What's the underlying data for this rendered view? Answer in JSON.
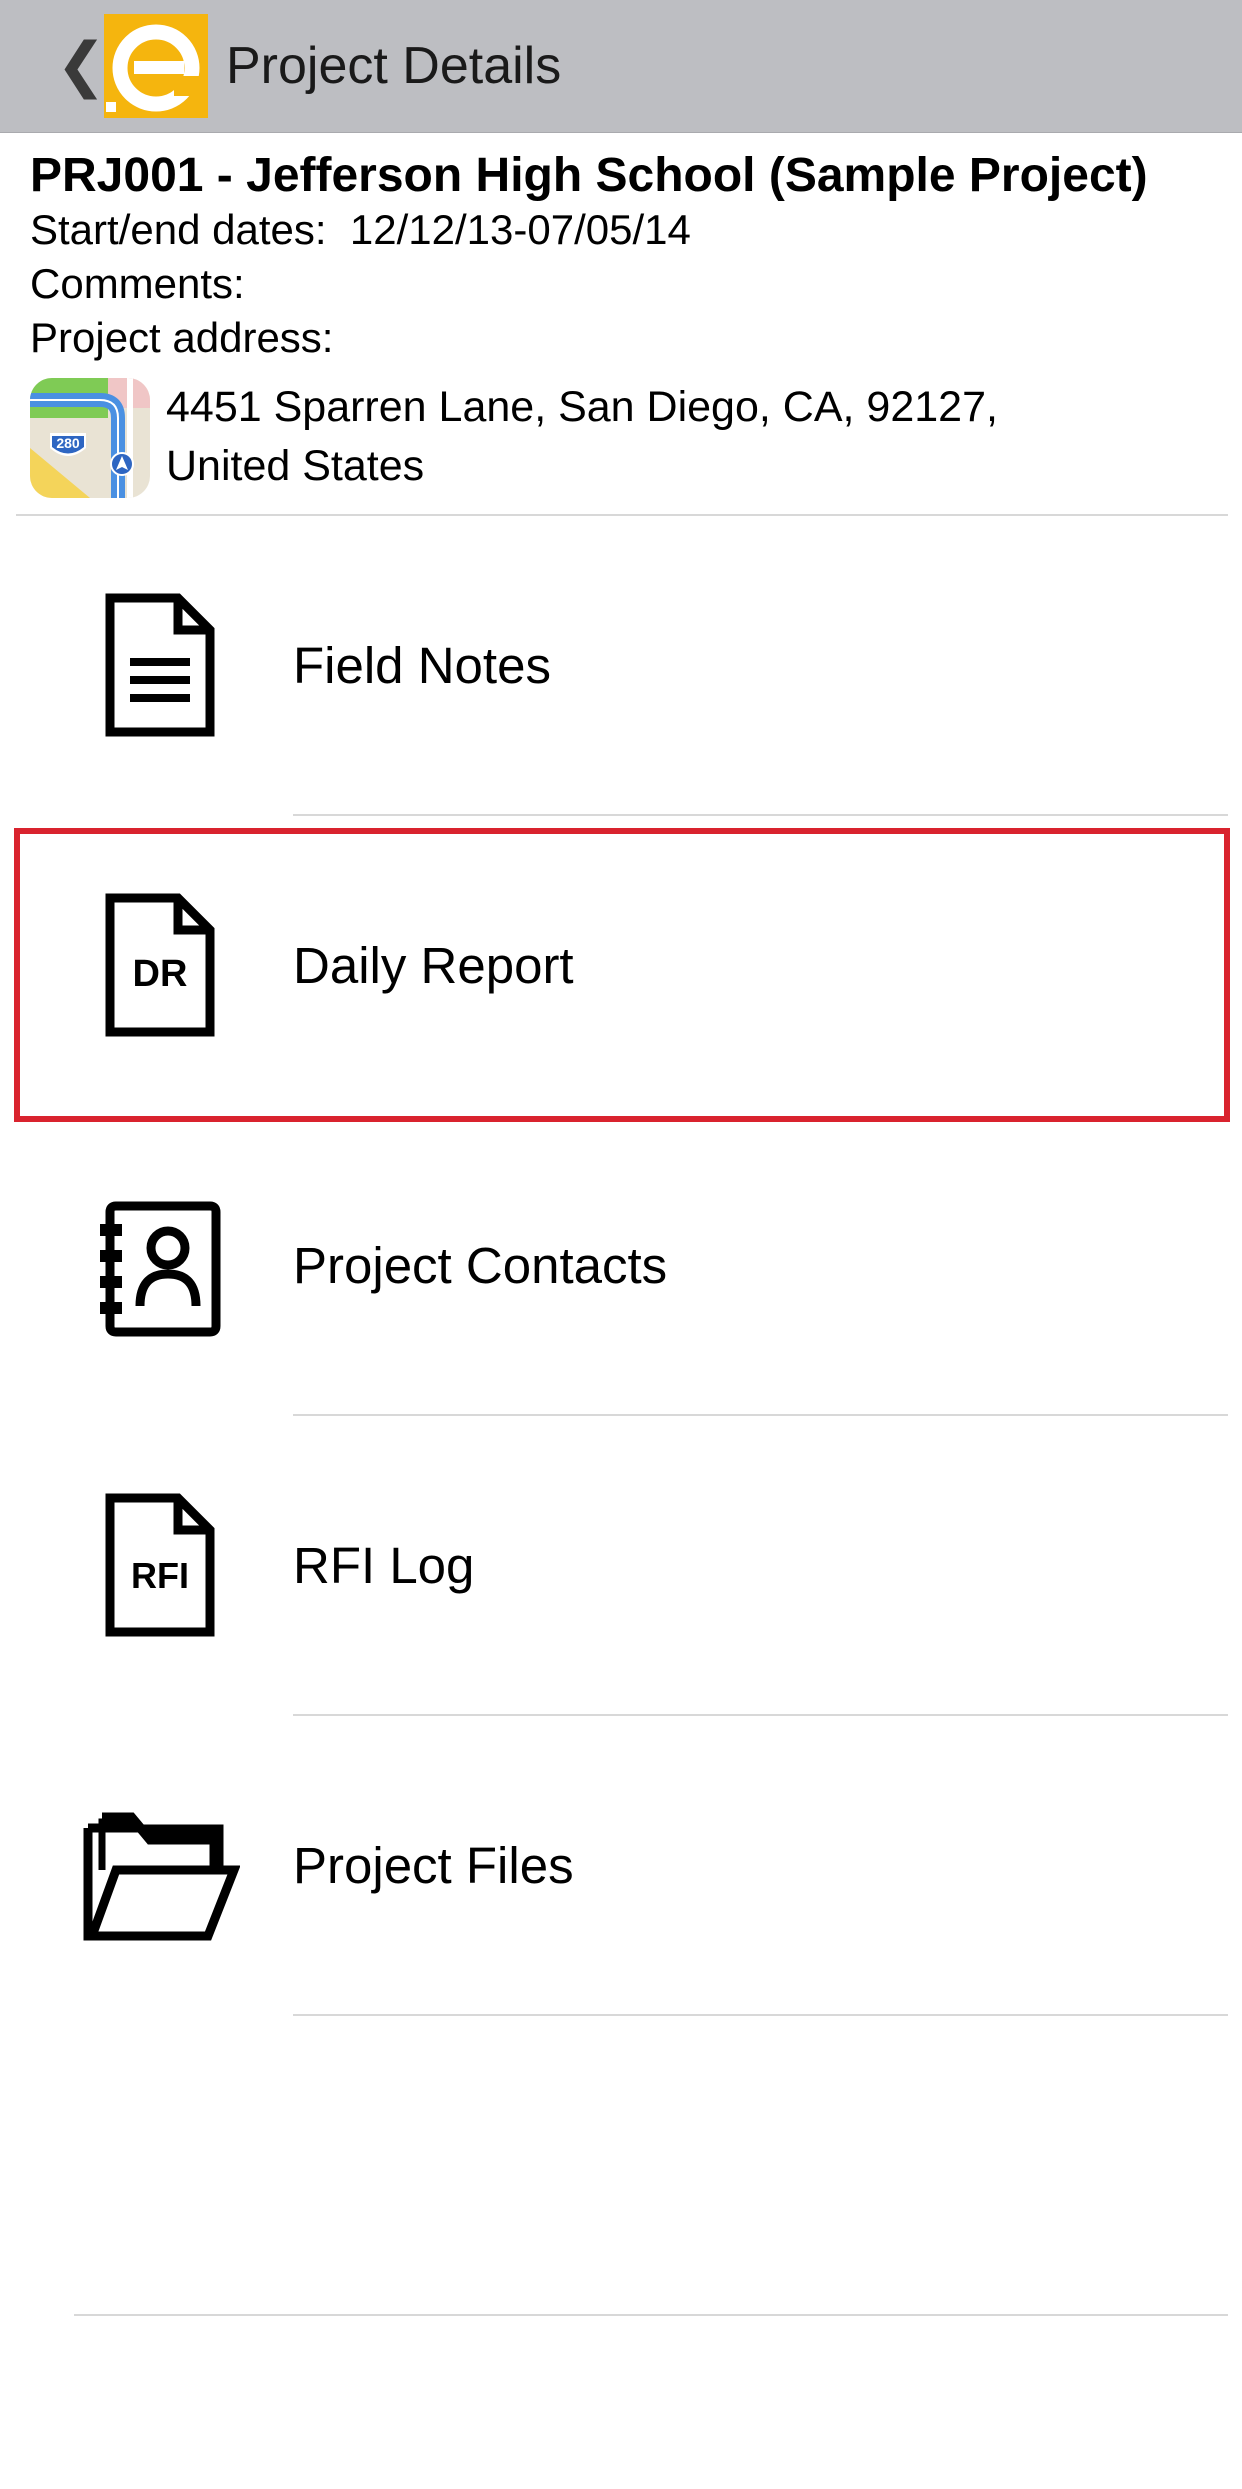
{
  "navbar": {
    "back_label": "❮",
    "logo_letter": "e",
    "title": "Project Details"
  },
  "project": {
    "title": "PRJ001 - Jefferson High School (Sample Project)",
    "dates_label": "Start/end dates:",
    "dates_value": "12/12/13-07/05/14",
    "comments_label": "Comments:",
    "address_label": "Project address:",
    "address_line1": "4451 Sparren Lane, San Diego, CA, 92127,",
    "address_line2": "United States",
    "map_shield": "280"
  },
  "menu": {
    "items": [
      {
        "label": "Field Notes",
        "icon": "document-lines-icon"
      },
      {
        "label": "Daily Report",
        "icon": "daily-report-document-icon",
        "icon_text": "DR",
        "highlighted": true
      },
      {
        "label": "Project Contacts",
        "icon": "address-book-icon"
      },
      {
        "label": "RFI Log",
        "icon": "rfi-document-icon",
        "icon_text": "RFI"
      },
      {
        "label": "Project Files",
        "icon": "folder-open-icon"
      }
    ]
  },
  "colors": {
    "navbar_bg": "#bdbec2",
    "logo_bg": "#f5b50e",
    "highlight": "#d9232e",
    "divider": "#d8d8d8"
  }
}
